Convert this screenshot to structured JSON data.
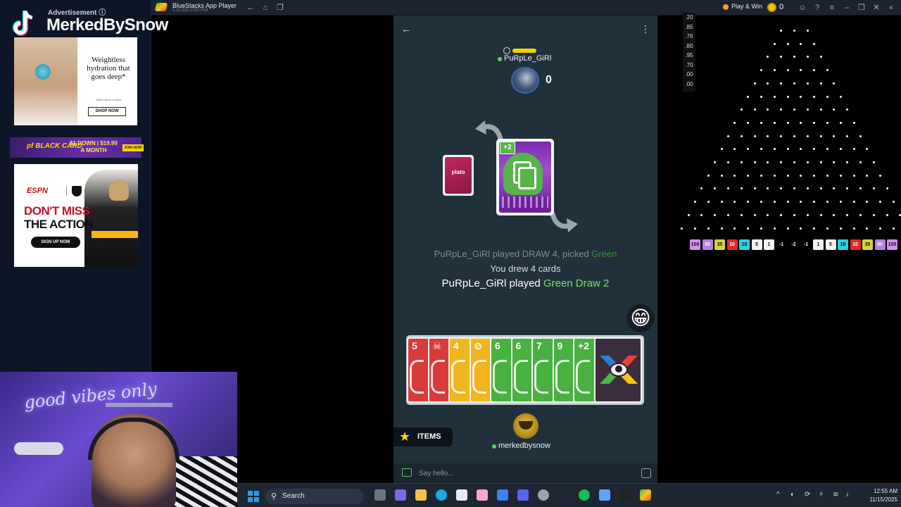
{
  "left_panel": {
    "advertisement_label": "Advertisement ⓘ",
    "streamer_name": "MerkedBySnow",
    "ad1": {
      "headline": "Weightless hydration that goes deep*",
      "button": "SHOP NOW",
      "fine_print": "*within skin's surface"
    },
    "ad2": {
      "brand": "pf BLACK CARD",
      "offer": "$1 DOWN | $19.99 A MONTH",
      "cta": "JOIN NOW"
    },
    "ad3": {
      "brand": "ESPN",
      "headline_1": "DON'T MISS",
      "headline_2": "THE ACTION",
      "cta": "SIGN UP NOW"
    }
  },
  "titlebar": {
    "app_title": "BlueStacks App Player",
    "app_subtitle": "5.21.630.1002  P64",
    "play_win": "Play & Win",
    "coin_count": "0"
  },
  "game": {
    "opponent": {
      "name": "PuRpLe_GiRl",
      "card_count": "0"
    },
    "draw_pile_logo": "plato",
    "discard": {
      "tag": "+2",
      "color": "#56b548"
    },
    "log": {
      "line1_prefix": "PuRpLe_GiRl played DRAW 4, picked ",
      "line1_highlight": "Green",
      "line2": "You drew 4 cards",
      "line3_prefix": "PuRpLe_GiRl played ",
      "line3_highlight": "Green Draw 2"
    },
    "emoji": "😁",
    "hand": [
      {
        "label": "5",
        "color": "#d93a3a"
      },
      {
        "label": "☠",
        "color": "#d93a3a"
      },
      {
        "label": "4",
        "color": "#f1b51d"
      },
      {
        "label": "⊘",
        "color": "#f1b51d"
      },
      {
        "label": "6",
        "color": "#48b13f"
      },
      {
        "label": "6",
        "color": "#48b13f"
      },
      {
        "label": "7",
        "color": "#48b13f"
      },
      {
        "label": "9",
        "color": "#48b13f"
      },
      {
        "label": "+2",
        "color": "#48b13f"
      }
    ],
    "items_label": "ITEMS",
    "me": {
      "name": "merkedbysnow"
    },
    "chat_placeholder": "Say hello..."
  },
  "plinko": {
    "odds": [
      ".20",
      ".85",
      ".76",
      ".80",
      ".95",
      ".70",
      ".00",
      ".00"
    ],
    "buckets": [
      {
        "label": "100",
        "color": "#d88cf0"
      },
      {
        "label": "50",
        "color": "#b77fe0"
      },
      {
        "label": "35",
        "color": "#d7d23a"
      },
      {
        "label": "10",
        "color": "#e02b2b"
      },
      {
        "label": "10",
        "color": "#2bd0e0"
      },
      {
        "label": "5",
        "color": "#f2f2f2"
      },
      {
        "label": "1",
        "color": "#f2f2f2"
      },
      {
        "label": "-1",
        "color": ""
      },
      {
        "label": "-2",
        "color": ""
      },
      {
        "label": "-1",
        "color": ""
      },
      {
        "label": "1",
        "color": "#f2f2f2"
      },
      {
        "label": "5",
        "color": "#f2f2f2"
      },
      {
        "label": "10",
        "color": "#2bd0e0"
      },
      {
        "label": "10",
        "color": "#e02b2b"
      },
      {
        "label": "35",
        "color": "#d7d23a"
      },
      {
        "label": "50",
        "color": "#b77fe0"
      },
      {
        "label": "100",
        "color": "#d88cf0"
      }
    ]
  },
  "webcam": {
    "neon_text": "good vibes only"
  },
  "taskbar": {
    "search_label": "Search",
    "time": "12:55 AM",
    "date": "11/15/2025"
  }
}
